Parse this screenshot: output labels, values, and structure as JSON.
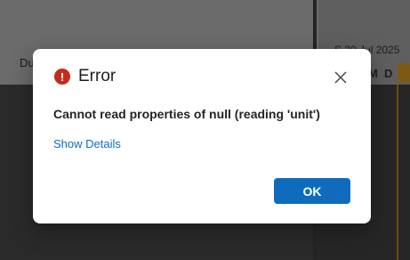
{
  "background": {
    "left_label": "Du",
    "date_header": "S    30 Jul 2025",
    "day_col_m": "M",
    "day_col_d": "D"
  },
  "dialog": {
    "icon": "error-circle-icon",
    "title": "Error",
    "message": "Cannot read properties of null (reading 'unit')",
    "details_link": "Show Details",
    "ok_label": "OK",
    "close_icon": "close-icon"
  },
  "colors": {
    "error": "#c42b1c",
    "primary": "#0f6cbd",
    "link": "#0f6cbd"
  }
}
